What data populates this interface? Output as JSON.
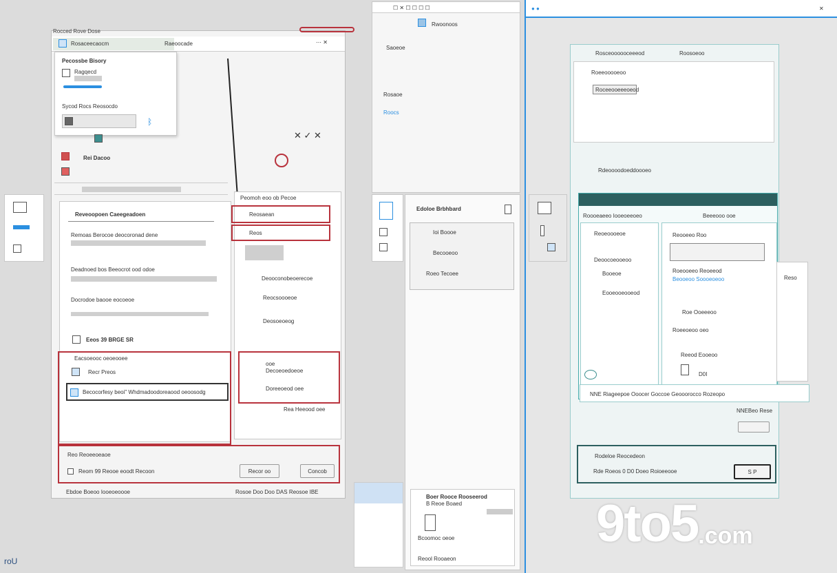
{
  "colors": {
    "accent_red": "#b8323c",
    "accent_blue": "#2b8fe0",
    "teal": "#3d8f8f"
  },
  "left_window": {
    "title_strip": "Rocced Rove Dose",
    "header_tab": "Rosaceecaocm",
    "header_tab2": "Raeoocade",
    "popup": {
      "title": "Pecossbe Bisory",
      "item1": "Ragqecd",
      "section": "Sycod Rocs Reosocdo"
    },
    "rows": [
      "Rei Dacoo"
    ],
    "middle": {
      "title": "Reveoopoen Caeegeadoen",
      "para1": "Remoas Berocoe deocoronad dene",
      "para2": "Deadnoed bos Beeocrot ood odoe",
      "para3": "Docrodoe baooe eocoeoe",
      "pill": "Eeos 39 BRGE SR",
      "sub_title": "Eacsoeooc oeoeooee",
      "sub_item": "Recr Preos",
      "field": "Becocorfesy beoi\" Whdmadoodoreaood oeoosodg"
    },
    "right_sub": {
      "title": "Peomoh eoo ob Pecoe",
      "item1": "Reosaean",
      "item2": "Reos",
      "list": [
        "Deooconobeoerecoe",
        "Reocsoooeoe",
        "Deosoeoeog"
      ],
      "rows2": [
        "ooe",
        "Decoeoedoeoe",
        "Doreeoeod oee",
        "Rea Heeood oee"
      ]
    },
    "bottom": {
      "label": "Reo Reoeeoeaoe",
      "check": "Reom 99 Reooe eoodt Recoon",
      "btn1": "Recor oo",
      "btn2": "Concob"
    },
    "status": {
      "left": "Ebdoe Boeoo Iooeoeoooe",
      "right": "Rosoe Doo Doo DAS Reosoe IBE"
    }
  },
  "middle_window": {
    "header": "Rwoonoos",
    "side_items": [
      "Saoeoe",
      "Rosaoe",
      "Roocs"
    ],
    "panel_title": "Edoloe Brbhbard",
    "panel_items": [
      "Ioi Boooe",
      "Becooeoo",
      "Roeo Tecoee"
    ],
    "bottom_title": "Boer Rooce Rooseerod",
    "bottom_sub": "B Reoe Boaed",
    "bottom_item": "Bcoomoc oeoe",
    "bottom_footer": "Reool Rooaeon"
  },
  "right_window": {
    "title": "Rosceoooooceeeod",
    "title_right": "Roosoeoo",
    "sub1": "Roeeooooeoo",
    "field1": "Roceeooeeeoeod",
    "bar_title": "Rdeoooodoeddoooeo",
    "teal_header": "Roooeaeeo Iooeoeeoeo",
    "teal_right": "Beeeooo ooe",
    "left_list": [
      "Reoeoooeoe",
      "Deoocoeooeoo",
      "Booeoe",
      "Eooeooeooeod"
    ],
    "right_list": [
      "Reooeeo Roo",
      "Roeooeeo Reoeeod",
      "Beooeoo Soooeoeoo"
    ],
    "small_items": [
      "Roe Ooeeeoo",
      "Roeeoeoo oeo"
    ],
    "check_label": "Reeod Eooeoo",
    "check_val": "D0I",
    "strip": "NNE Riageepoe Ooocer Goccoe Geooorocco Rozeopo",
    "lower_label": "NNEBeo Rese",
    "footer_row1": "Rodeloe Reocedeon",
    "footer_row2": "Rde Roeos 0 D0 Doeo Roioeeooe",
    "footer_btn": "S P",
    "side_label": "Reso"
  },
  "watermark": {
    "brand": "9to5",
    "suffix": ".com"
  },
  "bottom_left_text": "roU"
}
